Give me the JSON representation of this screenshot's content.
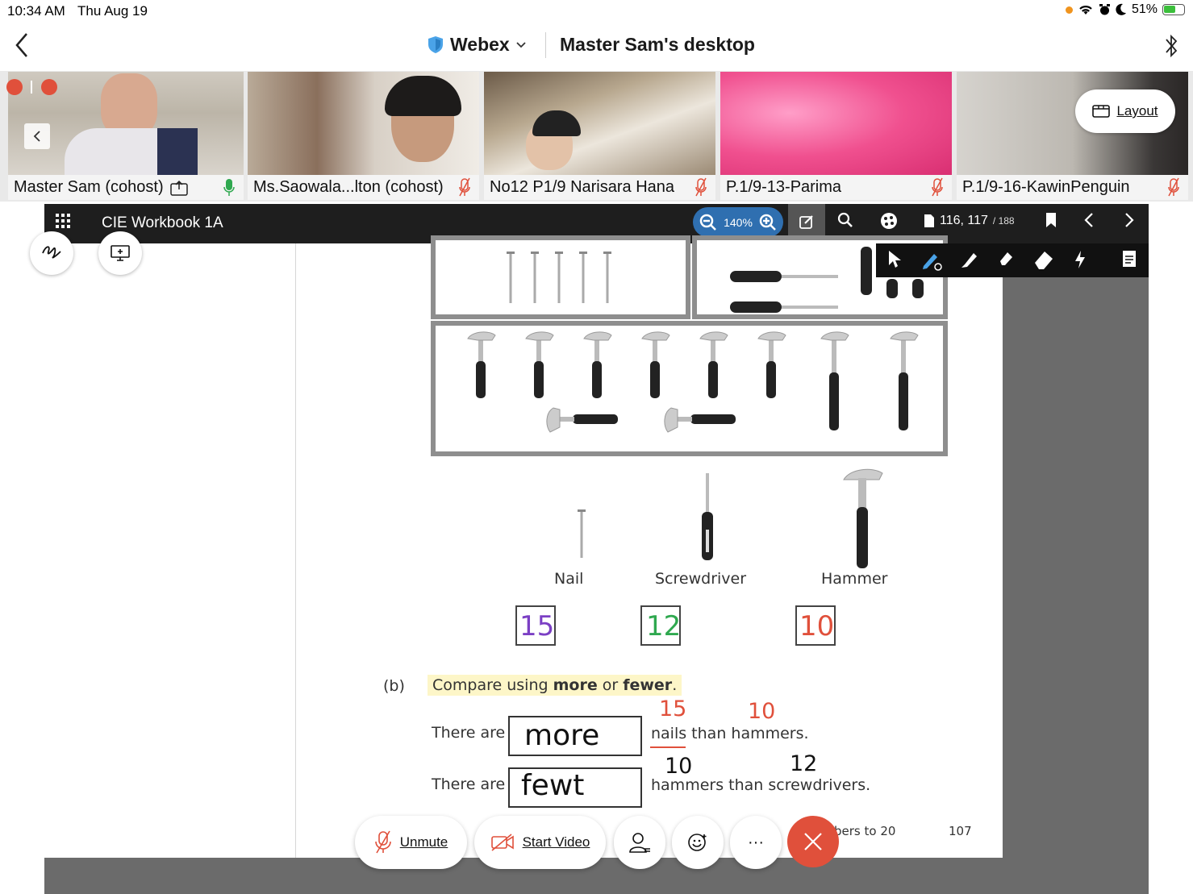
{
  "status_bar": {
    "time": "10:34 AM",
    "date": "Thu Aug 19",
    "battery": "51%"
  },
  "header": {
    "app_name": "Webex",
    "meeting_title": "Master Sam's desktop"
  },
  "participants": [
    {
      "name": "Master Sam (cohost)"
    },
    {
      "name": "Ms.Saowala...lton (cohost)"
    },
    {
      "name": "No12 P1/9 Narisara Hana"
    },
    {
      "name": "P.1/9-13-Parima"
    },
    {
      "name": "P.1/9-16-KawinPenguin"
    }
  ],
  "layout_button": "Layout",
  "share_toolbar": {
    "doc_title": "CIE Workbook 1A",
    "zoom": "140%",
    "pages": "116, 117",
    "total_pages": "/ 188"
  },
  "worksheet": {
    "tool_labels": [
      "Nail",
      "Screwdriver",
      "Hammer"
    ],
    "counts": [
      "15",
      "12",
      "10"
    ],
    "part": "(b)",
    "instruction_start": "Compare using ",
    "instruction_more": "more",
    "instruction_or": " or ",
    "instruction_fewer": "fewer",
    "instruction_end": ".",
    "row1_prefix": "There are",
    "row1_answer": "more",
    "row1_suffix": "nails than hammers.",
    "row1_note_left": "15",
    "row1_note_right": "10",
    "row2_prefix": "There are",
    "row2_answer": "fewt",
    "row2_suffix": "hammers than screwdrivers.",
    "row2_note_left": "10",
    "row2_note_right": "12",
    "footer_text": "bers to 20",
    "page_number": "107"
  },
  "controls": {
    "unmute": "Unmute",
    "start_video": "Start Video",
    "more": "···"
  },
  "colors": {
    "end_call": "#e0503b",
    "zoom_pill": "#2f6fb0",
    "count_nail": "#7b3fc4",
    "count_screwdriver": "#2fa84f",
    "count_hammer": "#e0503b"
  }
}
